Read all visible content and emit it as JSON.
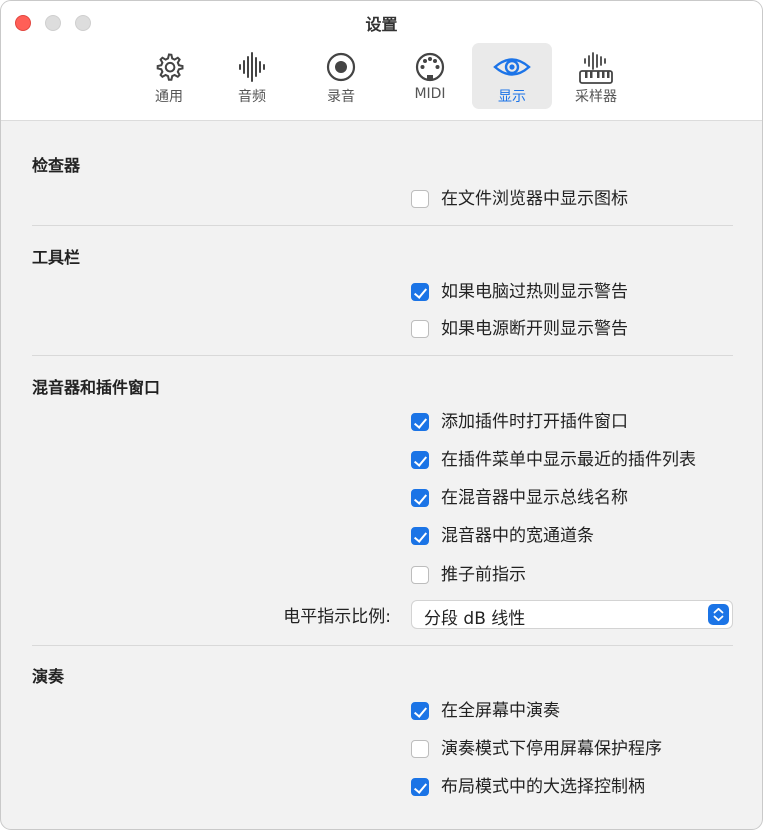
{
  "window": {
    "title": "设置"
  },
  "tabs": [
    {
      "label": "通用",
      "icon": "gear-icon"
    },
    {
      "label": "音频",
      "icon": "waveform-icon"
    },
    {
      "label": "录音",
      "icon": "record-icon"
    },
    {
      "label": "MIDI",
      "icon": "midi-port-icon"
    },
    {
      "label": "显示",
      "icon": "eye-icon",
      "active": true
    },
    {
      "label": "采样器",
      "icon": "sampler-keyboard-icon"
    }
  ],
  "sections": {
    "inspector": {
      "title": "检查器",
      "options": [
        {
          "label": "在文件浏览器中显示图标",
          "checked": false
        }
      ]
    },
    "toolbar": {
      "title": "工具栏",
      "options": [
        {
          "label": "如果电脑过热则显示警告",
          "checked": true
        },
        {
          "label": "如果电源断开则显示警告",
          "checked": false
        }
      ]
    },
    "mixer": {
      "title": "混音器和插件窗口",
      "options": [
        {
          "label": "添加插件时打开插件窗口",
          "checked": true
        },
        {
          "label": "在插件菜单中显示最近的插件列表",
          "checked": true
        },
        {
          "label": "在混音器中显示总线名称",
          "checked": true
        },
        {
          "label": "混音器中的宽通道条",
          "checked": true
        },
        {
          "label": "推子前指示",
          "checked": false
        }
      ],
      "meter_scale": {
        "label": "电平指示比例:",
        "value": "分段 dB 线性"
      }
    },
    "performance": {
      "title": "演奏",
      "options": [
        {
          "label": "在全屏幕中演奏",
          "checked": true
        },
        {
          "label": "演奏模式下停用屏幕保护程序",
          "checked": false
        },
        {
          "label": "布局模式中的大选择控制柄",
          "checked": true
        }
      ]
    }
  },
  "colors": {
    "accent": "#1b74e6",
    "close_button": "#ff5f57"
  }
}
